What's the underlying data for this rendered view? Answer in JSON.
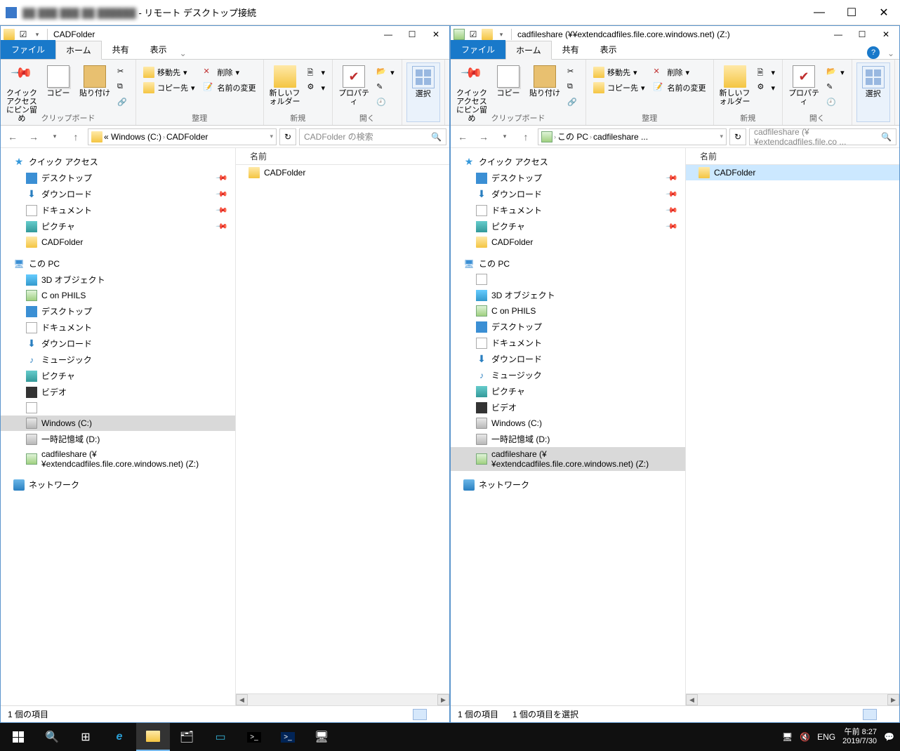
{
  "rdp": {
    "title_suffix": " - リモート デスクトップ接続"
  },
  "ribbon": {
    "tabs": {
      "file": "ファイル",
      "home": "ホーム",
      "share": "共有",
      "view": "表示"
    },
    "groups": {
      "clipboard": "クリップボード",
      "organize": "整理",
      "new": "新規",
      "open": "開く",
      "select": "選択"
    },
    "items": {
      "quickaccess": "クイック アクセスにピン留め",
      "copy": "コピー",
      "paste": "貼り付け",
      "moveto": "移動先",
      "copyto": "コピー先",
      "delete": "削除",
      "rename": "名前の変更",
      "newfolder": "新しいフォルダー",
      "properties": "プロパティ",
      "select": "選択"
    }
  },
  "left": {
    "title": "CADFolder",
    "breadcrumb": {
      "root": "«  Windows (C:)",
      "folder": "CADFolder"
    },
    "search_placeholder": "CADFolder の検索",
    "column": "名前",
    "files": [
      {
        "name": "CADFolder",
        "type": "folder",
        "selected": false
      }
    ],
    "status": "1 個の項目"
  },
  "right": {
    "title": "cadfileshare (¥¥extendcadfiles.file.core.windows.net) (Z:)",
    "breadcrumb": {
      "root": "この PC",
      "folder": "cadfileshare ..."
    },
    "search_placeholder": "cadfileshare (¥¥extendcadfiles.file.co ...",
    "column": "名前",
    "files": [
      {
        "name": "CADFolder",
        "type": "folder",
        "selected": true
      }
    ],
    "status": "1 個の項目",
    "status2": "1 個の項目を選択"
  },
  "nav": {
    "quick_access": "クイック アクセス",
    "desktop": "デスクトップ",
    "downloads": "ダウンロード",
    "documents": "ドキュメント",
    "pictures": "ピクチャ",
    "cadfolder": "CADFolder",
    "this_pc": "この PC",
    "objects3d": "3D オブジェクト",
    "c_on_phils": "C on PHILS",
    "music": "ミュージック",
    "videos": "ビデオ",
    "windows_c": "Windows (C:)",
    "temp_d": "一時記憶域 (D:)",
    "netshare": "cadfileshare (¥¥extendcadfiles.file.core.windows.net) (Z:)",
    "network": "ネットワーク"
  },
  "taskbar": {
    "lang": "ENG",
    "time": "午前 8:27",
    "date": "2019/7/30"
  }
}
